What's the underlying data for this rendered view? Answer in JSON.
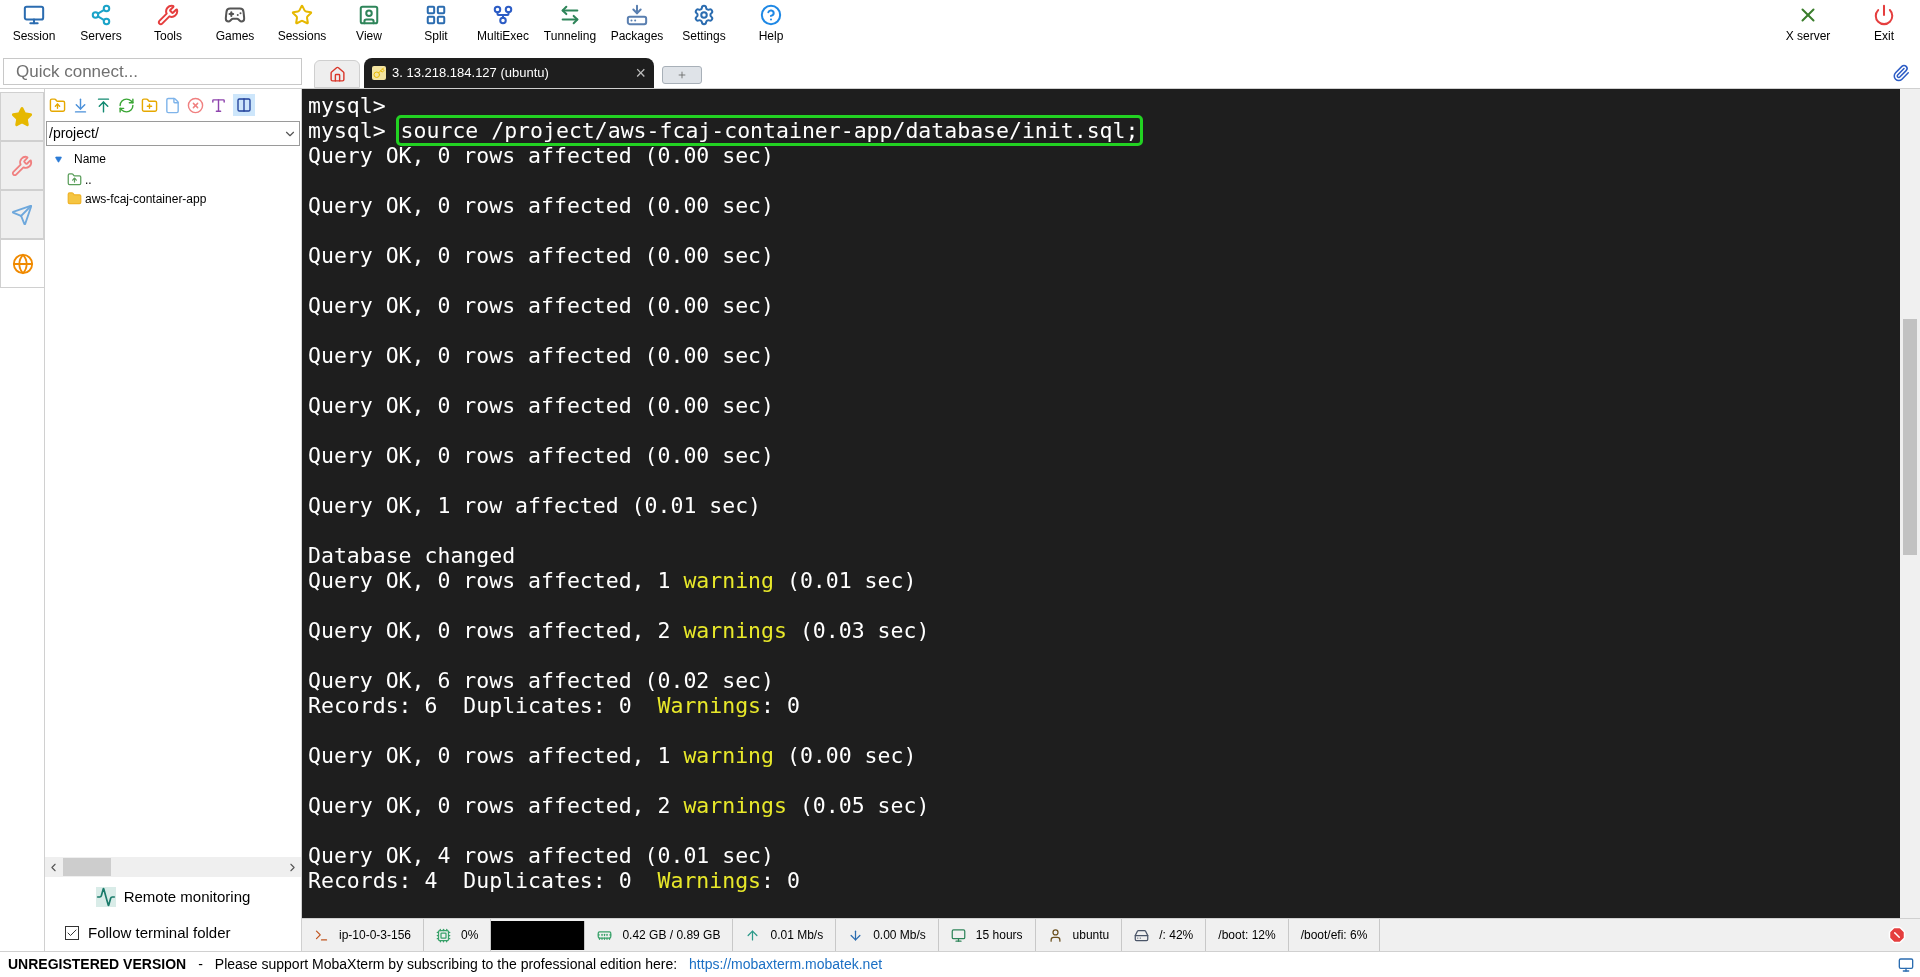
{
  "toolbar": [
    {
      "label": "Session",
      "kind": "session"
    },
    {
      "label": "Servers",
      "kind": "servers"
    },
    {
      "label": "Tools",
      "kind": "tools"
    },
    {
      "label": "Games",
      "kind": "games"
    },
    {
      "label": "Sessions",
      "kind": "sessions"
    },
    {
      "label": "View",
      "kind": "view"
    },
    {
      "label": "Split",
      "kind": "split"
    },
    {
      "label": "MultiExec",
      "kind": "multiexec"
    },
    {
      "label": "Tunneling",
      "kind": "tunneling"
    },
    {
      "label": "Packages",
      "kind": "packages"
    },
    {
      "label": "Settings",
      "kind": "settings"
    },
    {
      "label": "Help",
      "kind": "help"
    }
  ],
  "toolbar_right": [
    {
      "label": "X server",
      "kind": "xserver"
    },
    {
      "label": "Exit",
      "kind": "exit"
    }
  ],
  "quick_connect": {
    "placeholder": "Quick connect..."
  },
  "tabs": [
    {
      "kind": "home",
      "selected": false
    },
    {
      "kind": "session",
      "label": "3. 13.218.184.127 (ubuntu)",
      "close": "×",
      "selected": true
    },
    {
      "kind": "new",
      "selected": false
    }
  ],
  "side_tabs": [
    {
      "kind": "star",
      "selected": false
    },
    {
      "kind": "tools",
      "selected": false
    },
    {
      "kind": "plane",
      "selected": false
    },
    {
      "kind": "globe",
      "selected": true
    }
  ],
  "path": "/project/",
  "file_tree": {
    "header": "Name",
    "items": [
      {
        "name": "..",
        "kind": "parent"
      },
      {
        "name": "aws-fcaj-container-app",
        "kind": "folder"
      }
    ]
  },
  "remote_monitoring": "Remote monitoring",
  "follow_folder": {
    "label": "Follow terminal folder",
    "checked": true
  },
  "terminal": [
    {
      "kind": "line",
      "segments": [
        {
          "kind": "text",
          "text": "mysql>"
        }
      ]
    },
    {
      "kind": "line",
      "segments": [
        {
          "kind": "text",
          "text": "mysql> "
        },
        {
          "kind": "boxed",
          "text": "source /project/aws-fcaj-container-app/database/init.sql;"
        }
      ]
    },
    {
      "kind": "line",
      "segments": [
        {
          "kind": "text",
          "text": "Query OK, 0 rows affected (0.00 sec)"
        }
      ]
    },
    {
      "kind": "blank"
    },
    {
      "kind": "line",
      "segments": [
        {
          "kind": "text",
          "text": "Query OK, 0 rows affected (0.00 sec)"
        }
      ]
    },
    {
      "kind": "blank"
    },
    {
      "kind": "line",
      "segments": [
        {
          "kind": "text",
          "text": "Query OK, 0 rows affected (0.00 sec)"
        }
      ]
    },
    {
      "kind": "blank"
    },
    {
      "kind": "line",
      "segments": [
        {
          "kind": "text",
          "text": "Query OK, 0 rows affected (0.00 sec)"
        }
      ]
    },
    {
      "kind": "blank"
    },
    {
      "kind": "line",
      "segments": [
        {
          "kind": "text",
          "text": "Query OK, 0 rows affected (0.00 sec)"
        }
      ]
    },
    {
      "kind": "blank"
    },
    {
      "kind": "line",
      "segments": [
        {
          "kind": "text",
          "text": "Query OK, 0 rows affected (0.00 sec)"
        }
      ]
    },
    {
      "kind": "blank"
    },
    {
      "kind": "line",
      "segments": [
        {
          "kind": "text",
          "text": "Query OK, 0 rows affected (0.00 sec)"
        }
      ]
    },
    {
      "kind": "blank"
    },
    {
      "kind": "line",
      "segments": [
        {
          "kind": "text",
          "text": "Query OK, 1 row affected (0.01 sec)"
        }
      ]
    },
    {
      "kind": "blank"
    },
    {
      "kind": "line",
      "segments": [
        {
          "kind": "text",
          "text": "Database changed"
        }
      ]
    },
    {
      "kind": "line",
      "segments": [
        {
          "kind": "text",
          "text": "Query OK, 0 rows affected, 1 "
        },
        {
          "kind": "warn",
          "text": "warning"
        },
        {
          "kind": "text",
          "text": " (0.01 sec)"
        }
      ]
    },
    {
      "kind": "blank"
    },
    {
      "kind": "line",
      "segments": [
        {
          "kind": "text",
          "text": "Query OK, 0 rows affected, 2 "
        },
        {
          "kind": "warn",
          "text": "warnings"
        },
        {
          "kind": "text",
          "text": " (0.03 sec)"
        }
      ]
    },
    {
      "kind": "blank"
    },
    {
      "kind": "line",
      "segments": [
        {
          "kind": "text",
          "text": "Query OK, 6 rows affected (0.02 sec)"
        }
      ]
    },
    {
      "kind": "line",
      "segments": [
        {
          "kind": "text",
          "text": "Records: 6  Duplicates: 0  "
        },
        {
          "kind": "warn",
          "text": "Warnings"
        },
        {
          "kind": "text",
          "text": ": 0"
        }
      ]
    },
    {
      "kind": "blank"
    },
    {
      "kind": "line",
      "segments": [
        {
          "kind": "text",
          "text": "Query OK, 0 rows affected, 1 "
        },
        {
          "kind": "warn",
          "text": "warning"
        },
        {
          "kind": "text",
          "text": " (0.00 sec)"
        }
      ]
    },
    {
      "kind": "blank"
    },
    {
      "kind": "line",
      "segments": [
        {
          "kind": "text",
          "text": "Query OK, 0 rows affected, 2 "
        },
        {
          "kind": "warn",
          "text": "warnings"
        },
        {
          "kind": "text",
          "text": " (0.05 sec)"
        }
      ]
    },
    {
      "kind": "blank"
    },
    {
      "kind": "line",
      "segments": [
        {
          "kind": "text",
          "text": "Query OK, 4 rows affected (0.01 sec)"
        }
      ]
    },
    {
      "kind": "line",
      "segments": [
        {
          "kind": "text",
          "text": "Records: 4  Duplicates: 0  "
        },
        {
          "kind": "warn",
          "text": "Warnings"
        },
        {
          "kind": "text",
          "text": ": 0"
        }
      ]
    }
  ],
  "status_bar": [
    {
      "kind": "host",
      "text": "ip-10-0-3-156"
    },
    {
      "kind": "cpu",
      "text": "0%"
    },
    {
      "kind": "graph"
    },
    {
      "kind": "memory",
      "text": "0.42 GB / 0.89 GB"
    },
    {
      "kind": "upload",
      "text": "0.01 Mb/s"
    },
    {
      "kind": "download",
      "text": "0.00 Mb/s"
    },
    {
      "kind": "uptime",
      "text": "15 hours"
    },
    {
      "kind": "user",
      "text": "ubuntu"
    },
    {
      "kind": "disk",
      "text": "/: 42%"
    },
    {
      "kind": "plain",
      "text": "/boot: 12%"
    },
    {
      "kind": "plain",
      "text": "/boot/efi: 6%"
    }
  ],
  "footer": {
    "title": "UNREGISTERED VERSION",
    "separator": "-",
    "message": "Please support MobaXterm by subscribing to the professional edition here:",
    "link": "https://mobaxterm.mobatek.net"
  }
}
